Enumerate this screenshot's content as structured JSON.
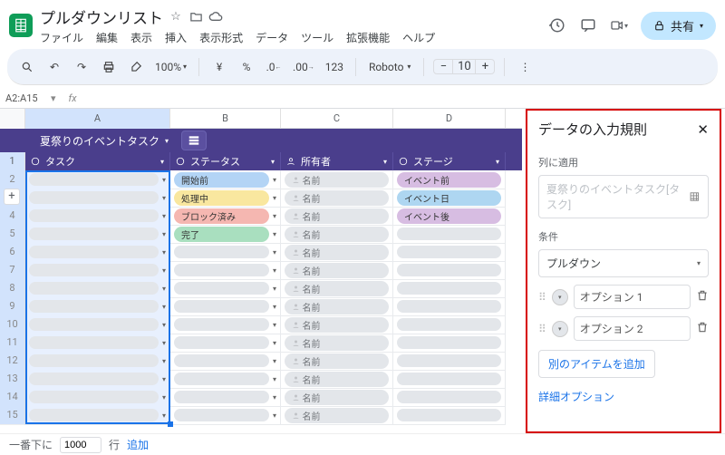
{
  "title": "プルダウンリスト",
  "menus": [
    "ファイル",
    "編集",
    "表示",
    "挿入",
    "表示形式",
    "データ",
    "ツール",
    "拡張機能",
    "ヘルプ"
  ],
  "share": "共有",
  "toolbar": {
    "zoom": "100%",
    "currency": "¥",
    "percent": "%",
    "dec_less": ".0",
    "dec_more": ".00",
    "format123": "123",
    "font": "Roboto",
    "fontsize": "10"
  },
  "namebox": "A2:A15",
  "columns": [
    "A",
    "B",
    "C",
    "D"
  ],
  "tab_chip": "夏祭りのイベントタスク",
  "headers": {
    "task": "タスク",
    "status": "ステータス",
    "owner": "所有者",
    "stage": "ステージ"
  },
  "status_vals": [
    "開始前",
    "処理中",
    "ブロック済み",
    "完了"
  ],
  "owner_label": "名前",
  "stage_vals": [
    "イベント前",
    "イベント日",
    "イベント後"
  ],
  "footer": {
    "prefix": "一番下に",
    "rows": "1000",
    "suffix": "行",
    "add": "追加"
  },
  "side": {
    "title": "データの入力規則",
    "apply_to": "列に適用",
    "apply_ph": "夏祭りのイベントタスク[タスク]",
    "cond": "条件",
    "cond_val": "プルダウン",
    "opt1": "オプション 1",
    "opt2": "オプション 2",
    "add_item": "別のアイテムを追加",
    "adv": "詳細オプション"
  }
}
